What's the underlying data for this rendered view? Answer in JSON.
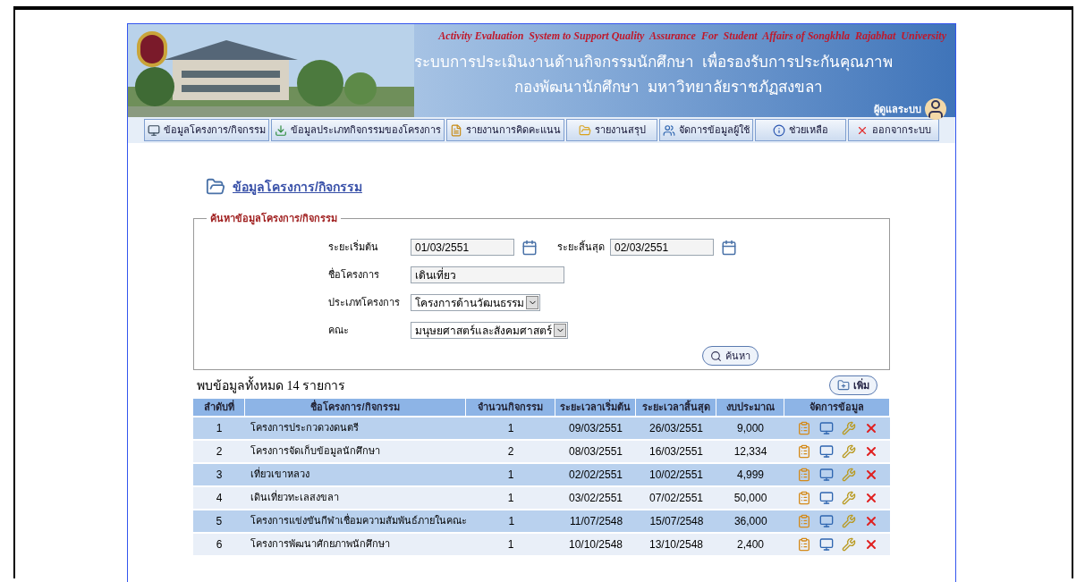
{
  "header": {
    "title_en": "Activity Evaluation  System to Support Quality  Assurance  For  Student  Affairs of Songkhla  Rajabhat  University",
    "title_th_1": "ระบบการประเมินงานด้านกิจกรรมนักศึกษา  เพื่อรองรับการประกันคุณภาพ",
    "title_th_2": "กองพัฒนานักศึกษา  มหาวิทยาลัยราชภัฏสงขลา",
    "user_label": "ผู้ดูแลระบบ"
  },
  "menu": [
    {
      "label": "ข้อมูลโครงการ/กิจกรรม",
      "kind": "monitor"
    },
    {
      "label": "ข้อมูลประเภทกิจกรรมของโครงการ",
      "kind": "download"
    },
    {
      "label": "รายงานการคิดคะแนน",
      "kind": "report"
    },
    {
      "label": "รายงานสรุป",
      "kind": "summary"
    },
    {
      "label": "จัดการข้อมูลผู้ใช้",
      "kind": "users"
    },
    {
      "label": "ช่วยเหลือ",
      "kind": "help"
    },
    {
      "label": "ออกจากระบบ",
      "kind": "logout"
    }
  ],
  "page_title": "ข้อมูลโครงการ/กิจกรรม",
  "search": {
    "legend": "ค้นหาข้อมูลโครงการ/กิจกรรม",
    "start_label": "ระยะเริ่มต้น",
    "start_value": "01/03/2551",
    "end_label": "ระยะสิ้นสุด",
    "end_value": "02/03/2551",
    "name_label": "ชื่อโครงการ",
    "name_value": "เดินเที่ยว",
    "type_label": "ประเภทโครงการ",
    "type_value": "โครงการด้านวัฒนธรรม",
    "faculty_label": "คณะ",
    "faculty_value": "มนุษยศาสตร์และสังคมศาสตร์",
    "button": "ค้นหา"
  },
  "result_count": "พบข้อมูลทั้งหมด 14 รายการ",
  "add_button": "เพิ่ม",
  "table": {
    "columns": [
      "ลำดับที่",
      "ชื่อโครงการ/กิจกรรม",
      "จำนวนกิจกรรม",
      "ระยะเวลาเริ่มต้น",
      "ระยะเวลาสิ้นสุด",
      "งบประมาณ",
      "จัดการข้อมูล"
    ],
    "rows": [
      [
        "1",
        "โครงการประกวดวงดนตรี",
        "1",
        "09/03/2551",
        "26/03/2551",
        "9,000"
      ],
      [
        "2",
        "โครงการจัดเก็บข้อมูลนักศึกษา",
        "2",
        "08/03/2551",
        "16/03/2551",
        "12,334"
      ],
      [
        "3",
        "เที่ยวเขาหลวง",
        "1",
        "02/02/2551",
        "10/02/2551",
        "4,999"
      ],
      [
        "4",
        "เดินเที่ยวทะเลสงขลา",
        "1",
        "03/02/2551",
        "07/02/2551",
        "50,000"
      ],
      [
        "5",
        "โครงการแข่งขันกีฬาเชื่อมความสัมพันธ์ภายในคณะ",
        "1",
        "11/07/2548",
        "15/07/2548",
        "36,000"
      ],
      [
        "6",
        "โครงการพัฒนาศักยภาพนักศึกษา",
        "1",
        "10/10/2548",
        "13/10/2548",
        "2,400"
      ]
    ]
  }
}
